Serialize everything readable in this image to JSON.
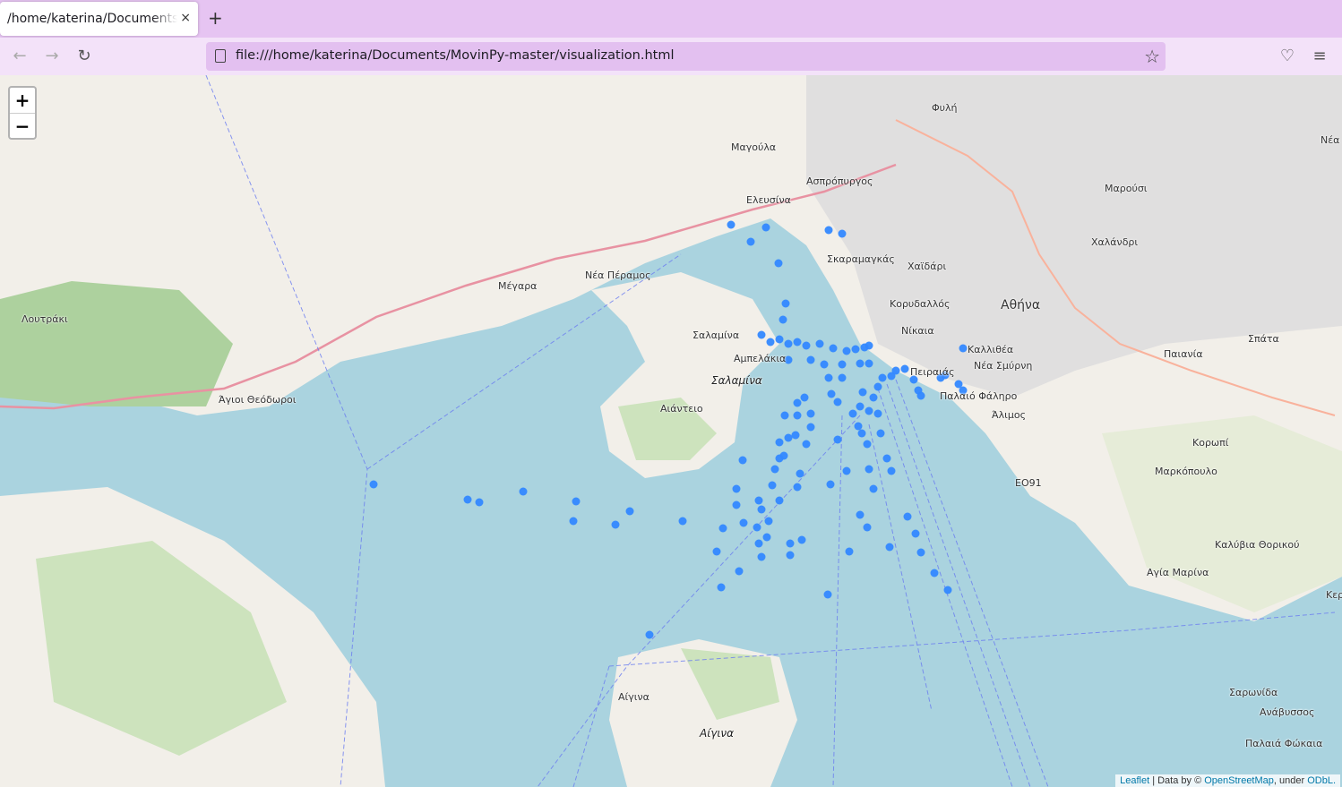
{
  "browser": {
    "tab_title": "/home/katerina/Documents/MovinPy-master/visualization.html",
    "tab_close": "×",
    "new_tab": "+",
    "url": "file:///home/katerina/Documents/MovinPy-master/visualization.html"
  },
  "map": {
    "zoom_in": "+",
    "zoom_out": "−",
    "attribution": {
      "leaflet": "Leaflet",
      "data_by": "| Data by ©",
      "osm": "OpenStreetMap",
      "under": ", under",
      "odbl": "ODbL."
    },
    "marker_color": "#3388ff",
    "labels": [
      {
        "text": "Φυλή",
        "cls": ""
      },
      {
        "text": "Μαγούλα",
        "cls": ""
      },
      {
        "text": "Ασπρόπυργος",
        "cls": ""
      },
      {
        "text": "Ελευσίνα",
        "cls": ""
      },
      {
        "text": "Μαρούσι",
        "cls": ""
      },
      {
        "text": "Χαλάνδρι",
        "cls": ""
      },
      {
        "text": "Χαϊδάρι",
        "cls": ""
      },
      {
        "text": "Σκαραμαγκάς",
        "cls": ""
      },
      {
        "text": "Μέγαρα",
        "cls": ""
      },
      {
        "text": "Νέα Πέραμος",
        "cls": ""
      },
      {
        "text": "Κορυδαλλός",
        "cls": ""
      },
      {
        "text": "Αθήνα",
        "cls": "big"
      },
      {
        "text": "Λουτράκι",
        "cls": ""
      },
      {
        "text": "Σαλαμίνα",
        "cls": ""
      },
      {
        "text": "Νίκαια",
        "cls": ""
      },
      {
        "text": "Σπάτα",
        "cls": ""
      },
      {
        "text": "Παιανία",
        "cls": ""
      },
      {
        "text": "Καλλιθέα",
        "cls": ""
      },
      {
        "text": "Αμπελάκια",
        "cls": ""
      },
      {
        "text": "Νέα Σμύρνη",
        "cls": ""
      },
      {
        "text": "Πειραιάς",
        "cls": ""
      },
      {
        "text": "Σαλαμίνα",
        "cls": "it"
      },
      {
        "text": "Παλαιό Φάληρο",
        "cls": ""
      },
      {
        "text": "Άγιοι Θεόδωροι",
        "cls": ""
      },
      {
        "text": "Αιάντειο",
        "cls": ""
      },
      {
        "text": "Άλιμος",
        "cls": ""
      },
      {
        "text": "Κορωπί",
        "cls": ""
      },
      {
        "text": "Μαρκόπουλο",
        "cls": ""
      },
      {
        "text": "ΕΟ91",
        "cls": ""
      },
      {
        "text": "Καλύβια Θορικού",
        "cls": ""
      },
      {
        "text": "Αγία Μαρίνα",
        "cls": ""
      },
      {
        "text": "Αίγινα",
        "cls": ""
      },
      {
        "text": "Αίγινα",
        "cls": "it"
      },
      {
        "text": "Σαρωνίδα",
        "cls": ""
      },
      {
        "text": "Ανάβυσσος",
        "cls": ""
      },
      {
        "text": "Παλαιά Φώκαια",
        "cls": ""
      },
      {
        "text": "Νέα",
        "cls": ""
      },
      {
        "text": "Κερ",
        "cls": ""
      }
    ]
  }
}
